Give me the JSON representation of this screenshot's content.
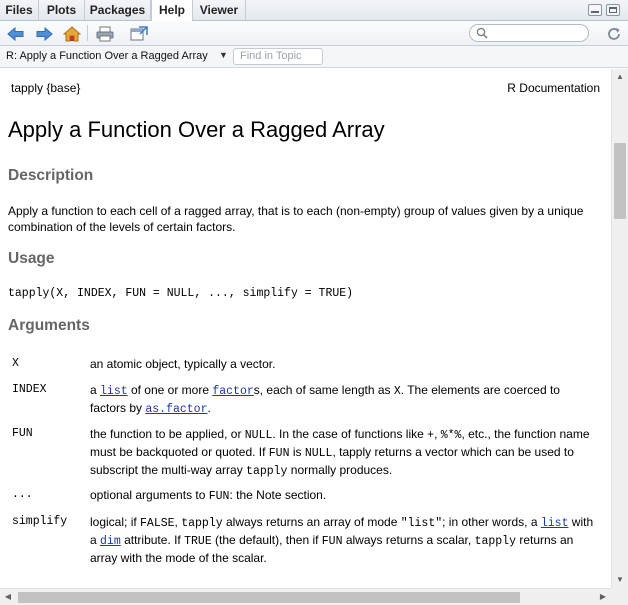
{
  "tabs": [
    {
      "label": "Files",
      "active": false
    },
    {
      "label": "Plots",
      "active": false
    },
    {
      "label": "Packages",
      "active": false
    },
    {
      "label": "Help",
      "active": true
    },
    {
      "label": "Viewer",
      "active": false
    }
  ],
  "toolbar": {
    "icons": [
      "back-arrow-icon",
      "forward-arrow-icon",
      "home-icon",
      "print-icon",
      "open-in-window-icon",
      "refresh-icon"
    ],
    "search_placeholder": ""
  },
  "topic_bar": {
    "title": "R: Apply a Function Over a Ragged Array",
    "find_placeholder": "Find in Topic"
  },
  "doc": {
    "package_tag": "tapply {base}",
    "doc_label": "R Documentation",
    "title": "Apply a Function Over a Ragged Array",
    "description_heading": "Description",
    "description_text": "Apply a function to each cell of a ragged array, that is to each (non-empty) group of values given by a unique combination of the levels of certain factors.",
    "usage_heading": "Usage",
    "usage_code": "tapply(X, INDEX, FUN = NULL, ..., simplify = TRUE)",
    "arguments_heading": "Arguments",
    "arguments": {
      "x": {
        "name": "X",
        "desc": "an atomic object, typically a vector."
      },
      "index": {
        "name": "INDEX",
        "p1": "a ",
        "link1": "list",
        "p2": " of one or more ",
        "link2": "factor",
        "p3": "s, each of same length as ",
        "code1": "X",
        "p4": ". The elements are coerced to factors by ",
        "link3": "as.factor",
        "p5": "."
      },
      "fun": {
        "name": "FUN",
        "p1": "the function to be applied, or ",
        "code1": "NULL",
        "p2": ". In the case of functions like ",
        "code2": "+",
        "p3": ", ",
        "code3": "%*%",
        "p4": ", etc., the function name must be backquoted or quoted. If ",
        "code4": "FUN",
        "p5": " is ",
        "code5": "NULL",
        "p6": ", tapply returns a vector which can be used to subscript the multi-way array ",
        "code6": "tapply",
        "p7": " normally produces."
      },
      "dots": {
        "name": "...",
        "p1": "optional arguments to ",
        "code1": "FUN",
        "p2": ": the Note section."
      },
      "simplify": {
        "name": "simplify",
        "p1": "logical; if ",
        "code1": "FALSE",
        "p2": ", ",
        "code2": "tapply",
        "p3": " always returns an array of mode ",
        "code3": "\"list\"",
        "p4": "; in other words, a ",
        "link1": "list",
        "p5": " with a ",
        "link2": "dim",
        "p6": " attribute. If ",
        "code4": "TRUE",
        "p7": " (the default), then if ",
        "code5": "FUN",
        "p8": " always returns a scalar, ",
        "code6": "tapply",
        "p9": " returns an array with the mode of the scalar."
      }
    }
  },
  "colors": {
    "link": "#1a35b5",
    "section_heading": "#666666",
    "tab_bar": "#e3e8ee"
  }
}
